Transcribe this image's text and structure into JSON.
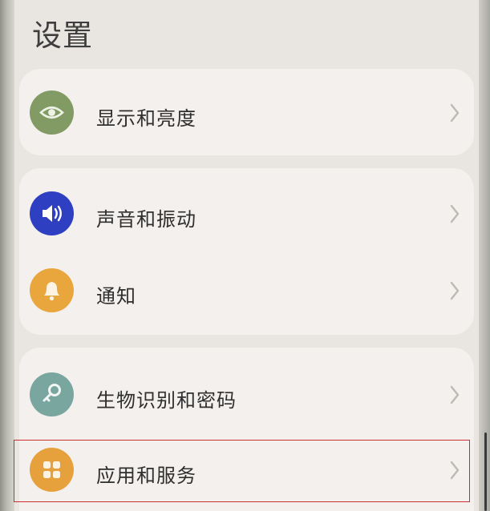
{
  "header": {
    "title": "设置"
  },
  "groups": [
    {
      "items": [
        {
          "label": "显示和亮度",
          "icon": "eye-icon",
          "color": "#829a63"
        }
      ]
    },
    {
      "items": [
        {
          "label": "声音和振动",
          "icon": "speaker-icon",
          "color": "#2f3fc2"
        },
        {
          "label": "通知",
          "icon": "bell-icon",
          "color": "#e9a63d"
        }
      ]
    },
    {
      "items": [
        {
          "label": "生物识别和密码",
          "icon": "key-icon",
          "color": "#7aa6a0"
        },
        {
          "label": "应用和服务",
          "icon": "apps-grid-icon",
          "color": "#e6a03c"
        }
      ]
    }
  ],
  "highlight_color": "#c92d2d"
}
